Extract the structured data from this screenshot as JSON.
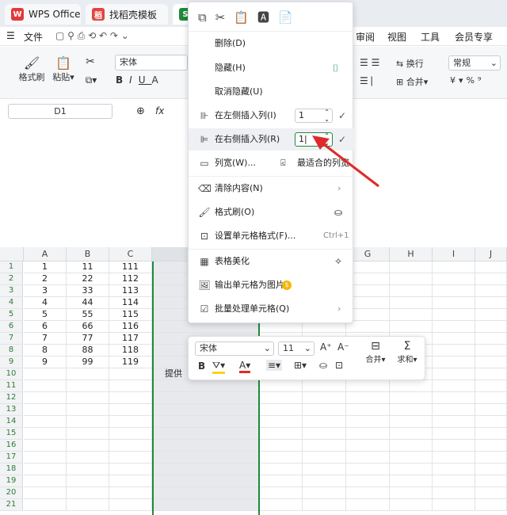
{
  "tabs": [
    {
      "label": "WPS Office",
      "logo": "W"
    },
    {
      "label": "找稻壳模板",
      "logo": "稻"
    },
    {
      "label": "",
      "logo": "S"
    }
  ],
  "menubar": {
    "file": "文件",
    "items": [
      "审阅",
      "视图",
      "工具",
      "会员专享"
    ]
  },
  "ribbon": {
    "format_painter": "格式刷",
    "paste": "粘贴",
    "font_name": "宋体",
    "wrap": "换行",
    "number_format": "常规",
    "merge": "合并"
  },
  "formula": {
    "cell_ref": "D1",
    "fx": "fx"
  },
  "columns": [
    "A",
    "B",
    "C",
    "D",
    "E",
    "F",
    "G",
    "H",
    "I",
    "J"
  ],
  "rows": [
    "1",
    "2",
    "3",
    "4",
    "5",
    "6",
    "7",
    "8",
    "9",
    "10",
    "11",
    "12",
    "13",
    "14",
    "15",
    "16",
    "17",
    "18",
    "19",
    "20",
    "21"
  ],
  "cells": {
    "A": [
      "1",
      "2",
      "3",
      "4",
      "5",
      "6",
      "7",
      "8",
      "9"
    ],
    "B": [
      "11",
      "22",
      "33",
      "44",
      "55",
      "66",
      "77",
      "88",
      "99"
    ],
    "C": [
      "111",
      "112",
      "113",
      "114",
      "115",
      "116",
      "117",
      "118",
      "119"
    ],
    "D10": "提供"
  },
  "context_menu": {
    "delete": "删除(D)",
    "hide": "隐藏(H)",
    "unhide": "取消隐藏(U)",
    "insert_left": "在左侧插入列(I)",
    "insert_left_value": "1",
    "insert_right": "在右侧插入列(R)",
    "insert_right_value": "1",
    "col_width": "列宽(W)...",
    "best_fit": "最适合的列宽",
    "clear": "清除内容(N)",
    "format_painter": "格式刷(O)",
    "format_cells": "设置单元格格式(F)...",
    "format_cells_shortcut": "Ctrl+1",
    "beautify": "表格美化",
    "export_image": "输出单元格为图片",
    "batch": "批量处理单元格(Q)"
  },
  "mini_toolbar": {
    "font": "宋体",
    "size": "11",
    "merge": "合并",
    "sum": "求和"
  },
  "colors": {
    "accent_green": "#1e8a3c",
    "arrow_red": "#e02a2a",
    "font_red": "#e02a2a",
    "highlight_yellow": "#f5d51b"
  }
}
